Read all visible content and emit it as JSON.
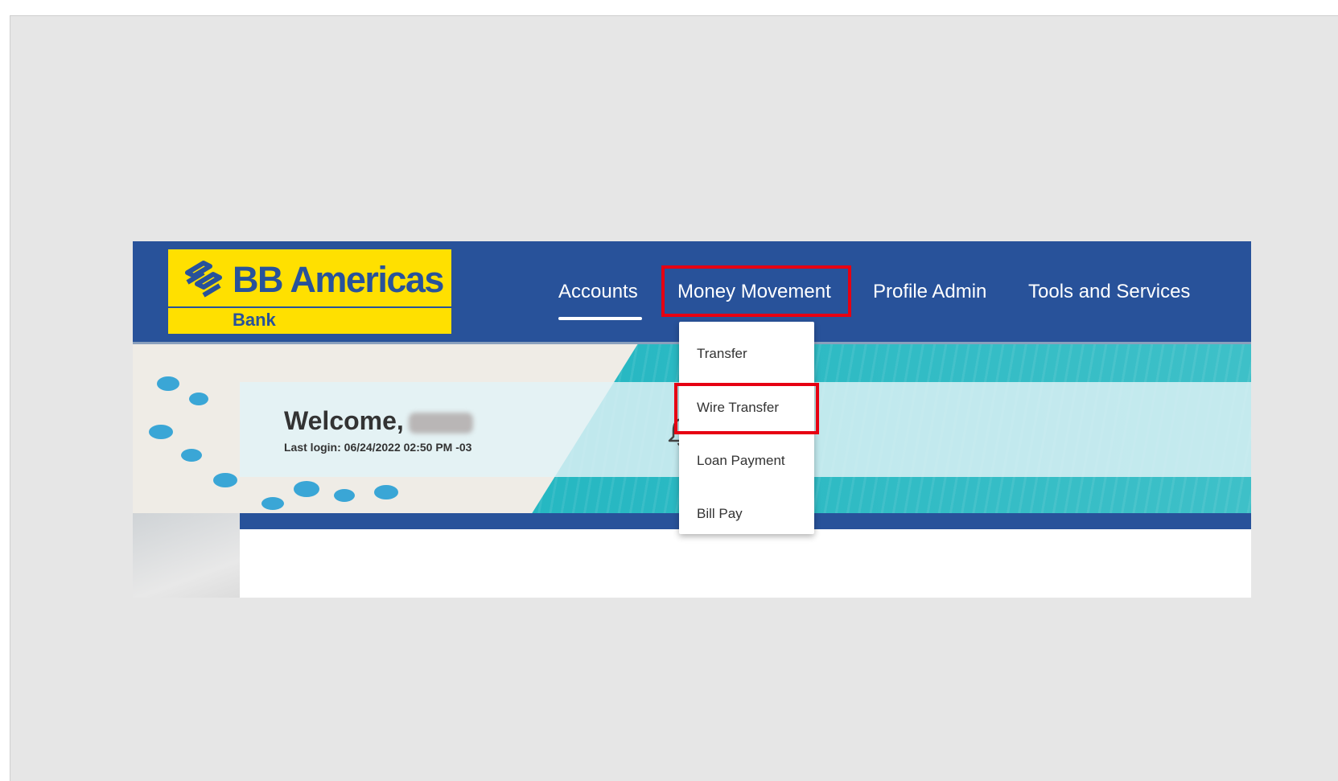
{
  "logo": {
    "title": "BB Americas",
    "subtitle": "Bank",
    "mark_icon": "bb-logo-icon"
  },
  "nav": {
    "items": [
      {
        "label": "Accounts",
        "active": true
      },
      {
        "label": "Money Movement",
        "highlighted": true
      },
      {
        "label": "Profile Admin"
      },
      {
        "label": "Tools and Services"
      }
    ]
  },
  "dropdown": {
    "items": [
      {
        "label": "Transfer"
      },
      {
        "label": "Wire Transfer",
        "highlighted": true
      },
      {
        "label": "Loan Payment"
      },
      {
        "label": "Bill Pay"
      }
    ]
  },
  "welcome": {
    "greeting": "Welcome,",
    "last_login": "Last login: 06/24/2022 02:50 PM -03"
  },
  "notifications": {
    "icon": "bell-icon",
    "count": "0"
  },
  "colors": {
    "brand_blue": "#28529a",
    "brand_yellow": "#ffe000",
    "highlight_red": "#e60012"
  }
}
